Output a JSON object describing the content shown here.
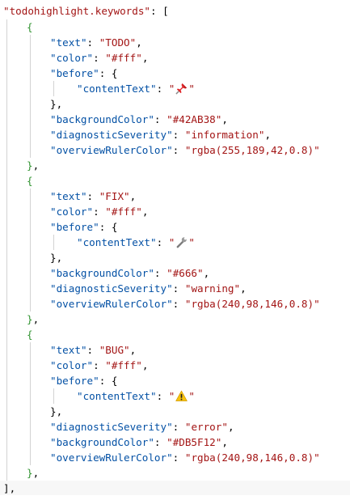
{
  "editor": {
    "root_key": "todohighlight.keywords",
    "items": [
      {
        "text": "TODO",
        "color": "#fff",
        "contentText_icon": "pushpin-icon",
        "backgroundColor": "#42AB38",
        "diagnosticSeverity": "information",
        "overviewRulerColor": "rgba(255,189,42,0.8)"
      },
      {
        "text": "FIX",
        "color": "#fff",
        "contentText_icon": "wrench-icon",
        "backgroundColor": "#666",
        "diagnosticSeverity": "warning",
        "overviewRulerColor": "rgba(240,98,146,0.8)"
      },
      {
        "text": "BUG",
        "color": "#fff",
        "contentText_icon": "warning-icon",
        "diagnosticSeverity": "error",
        "backgroundColor": "#DB5F12",
        "overviewRulerColor": "rgba(240,98,146,0.8)"
      }
    ],
    "keys": {
      "text": "text",
      "color": "color",
      "before": "before",
      "contentText": "contentText",
      "backgroundColor": "backgroundColor",
      "diagnosticSeverity": "diagnosticSeverity",
      "overviewRulerColor": "overviewRulerColor"
    },
    "colors": {
      "key": "#0451a5",
      "string": "#a31515",
      "bracket_level2": "#319331",
      "indent_guide": "#d3d3d3"
    }
  }
}
